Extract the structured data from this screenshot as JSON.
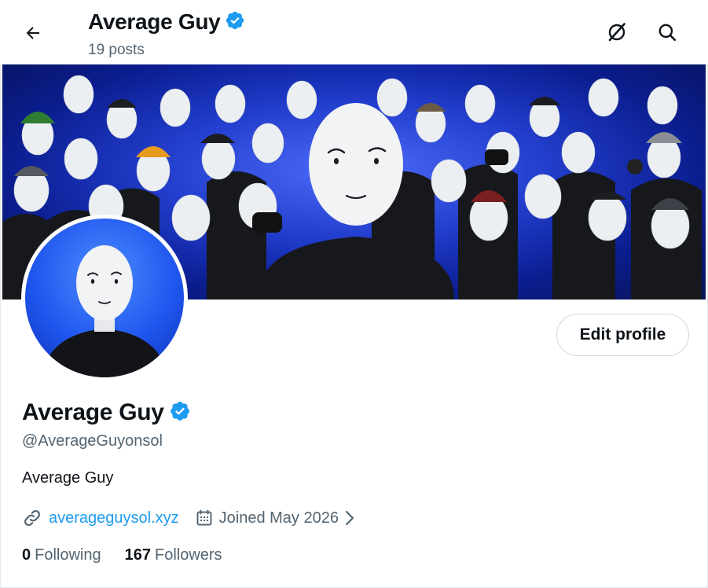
{
  "header": {
    "title": "Average Guy",
    "posts_count": "19 posts",
    "back_icon": "arrow-left-icon",
    "grok_icon": "grok-icon",
    "search_icon": "search-icon"
  },
  "profile": {
    "display_name": "Average Guy",
    "verified": true,
    "handle": "@AverageGuyonsol",
    "bio": "Average Guy",
    "website": "averageguysol.xyz",
    "joined": "Joined May 2026",
    "following_count": "0",
    "following_label": "Following",
    "followers_count": "167",
    "followers_label": "Followers",
    "edit_profile_label": "Edit profile"
  },
  "colors": {
    "accent": "#1d9bf0",
    "verified_badge": "#1d9bf0",
    "secondary_text": "#536471",
    "banner_blue": "#1d3ce0"
  }
}
